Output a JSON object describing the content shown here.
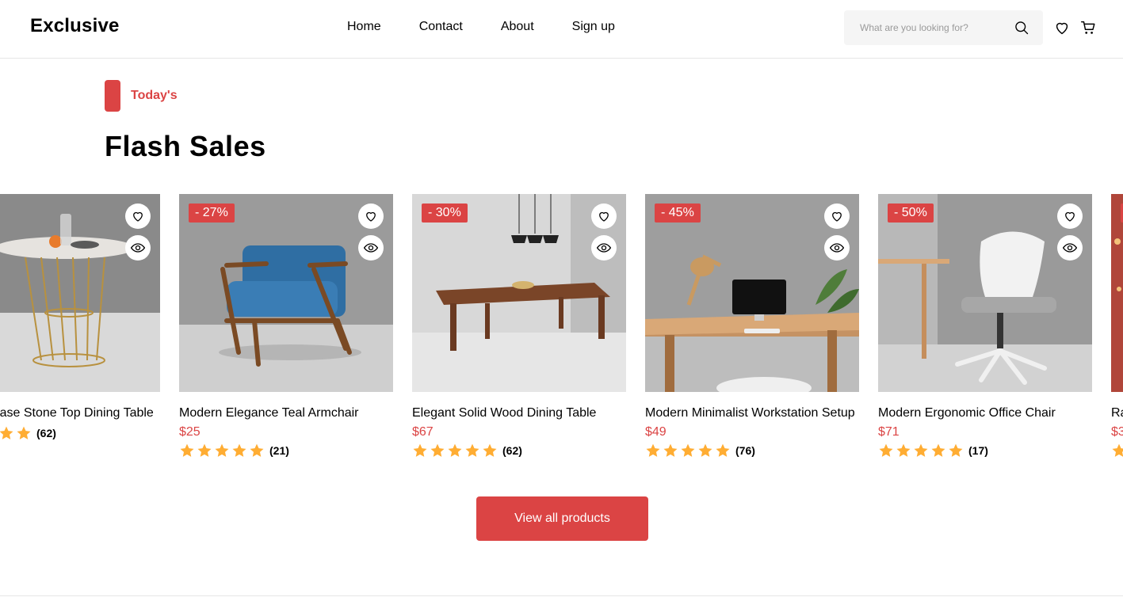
{
  "header": {
    "logo": "Exclusive",
    "nav": [
      "Home",
      "Contact",
      "About",
      "Sign up"
    ],
    "search_placeholder": "What are you looking for?",
    "icons": [
      "search-icon",
      "heart-icon",
      "cart-icon"
    ]
  },
  "section": {
    "tag": "Today's",
    "title": "Flash Sales"
  },
  "products": [
    {
      "name": "Golden-Base Stone Top Dining Table",
      "discount": "",
      "price": "",
      "stars": 5,
      "reviews": "(62)"
    },
    {
      "name": "Modern Elegance Teal Armchair",
      "discount": "- 27%",
      "price": "$25",
      "stars": 5,
      "reviews": "(21)"
    },
    {
      "name": "Elegant Solid Wood Dining Table",
      "discount": "- 30%",
      "price": "$67",
      "stars": 5,
      "reviews": "(62)"
    },
    {
      "name": "Modern Minimalist Workstation Setup",
      "discount": "- 45%",
      "price": "$49",
      "stars": 5,
      "reviews": "(76)"
    },
    {
      "name": "Modern Ergonomic Office Chair",
      "discount": "- 50%",
      "price": "$71",
      "stars": 5,
      "reviews": "(17)"
    },
    {
      "name": "Ra",
      "discount": "",
      "price": "$3",
      "stars": 5,
      "reviews": ""
    }
  ],
  "view_all_label": "View all products",
  "colors": {
    "accent": "#db4444",
    "star": "#ffad33",
    "search_bg": "#f5f5f5"
  }
}
